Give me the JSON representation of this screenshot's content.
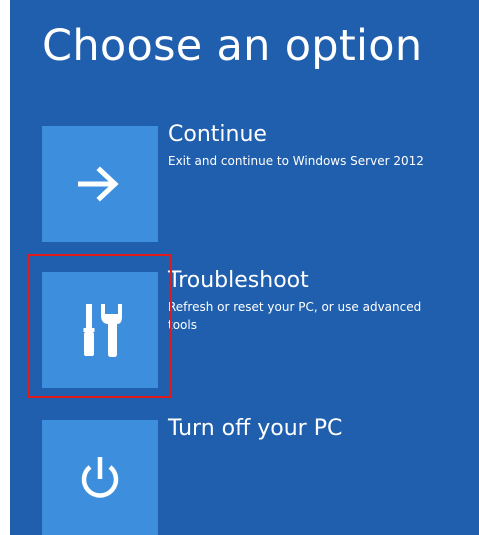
{
  "screen": {
    "title": "Choose an option",
    "background_color": "#1f5fad",
    "tile_color": "#3d8fdd",
    "highlight_color": "#e11b1b"
  },
  "options": [
    {
      "label": "Continue",
      "description": "Exit and continue to Windows Server 2012",
      "icon": "arrow-right-icon"
    },
    {
      "label": "Troubleshoot",
      "description": "Refresh or reset your PC, or use advanced tools",
      "icon": "tools-icon",
      "highlighted": true
    },
    {
      "label": "Turn off your PC",
      "description": "",
      "icon": "power-icon"
    }
  ]
}
